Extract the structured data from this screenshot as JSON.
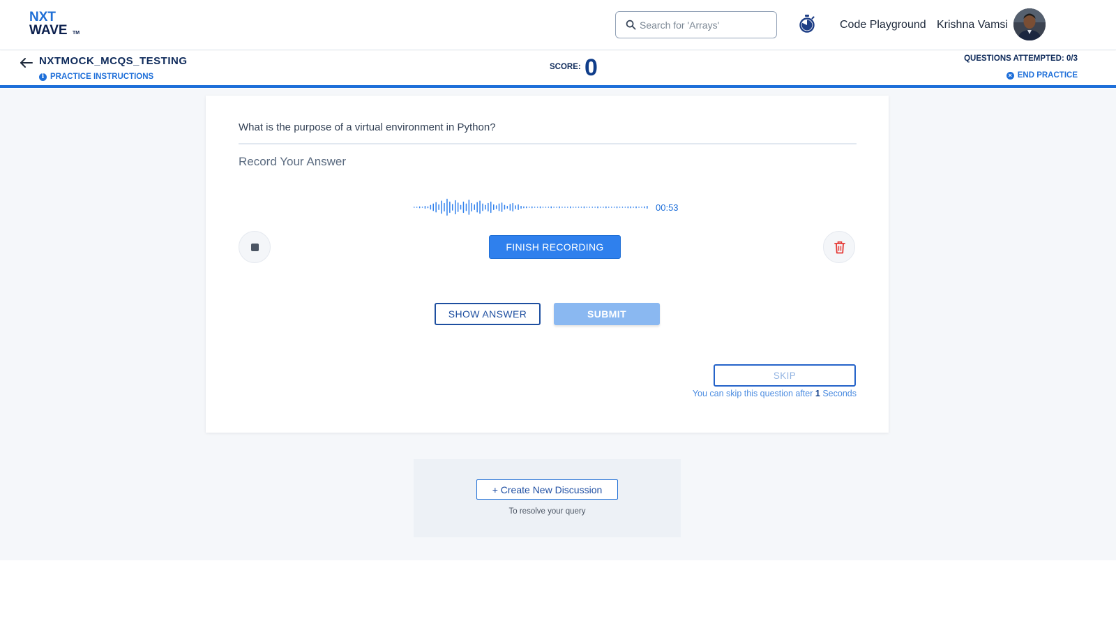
{
  "brand": {
    "line1": "NXT",
    "line2": "WAVE",
    "tm": "TM"
  },
  "header": {
    "search_placeholder": "Search for 'Arrays'",
    "timer_icon": "stopwatch-icon",
    "code_playground": "Code Playground",
    "user_name": "Krishna Vamsi"
  },
  "practice": {
    "title": "NXTMOCK_MCQS_TESTING",
    "instructions_label": "PRACTICE INSTRUCTIONS",
    "score_label": "SCORE:",
    "score_value": "0",
    "attempted_label": "QUESTIONS ATTEMPTED: 0/3",
    "end_label": "END PRACTICE"
  },
  "question": {
    "text": "What is the purpose of a virtual environment in Python?",
    "record_title": "Record Your Answer",
    "recording_time": "00:53",
    "finish_label": "FINISH RECORDING",
    "show_answer_label": "SHOW ANSWER",
    "submit_label": "SUBMIT",
    "skip_label": "SKIP",
    "skip_note_prefix": "You can skip this question after",
    "skip_seconds": "1",
    "skip_note_suffix": "Seconds"
  },
  "discussion": {
    "button_label": "+ Create New Discussion",
    "note": "To resolve your query"
  },
  "colors": {
    "primary": "#2f80ed",
    "navy": "#0f2b5b",
    "submit_disabled": "#8ab8f1",
    "danger": "#e53935"
  }
}
